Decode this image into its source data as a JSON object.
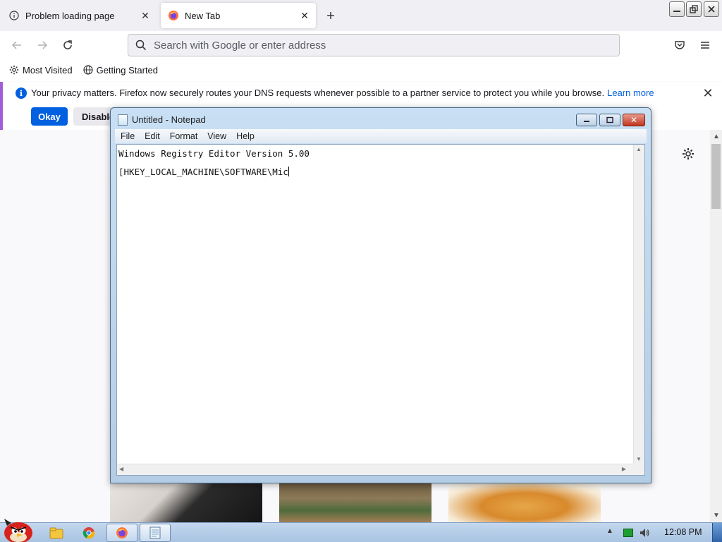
{
  "browser": {
    "tabs": [
      {
        "label": "Problem loading page",
        "icon": "info-icon",
        "active": false
      },
      {
        "label": "New Tab",
        "icon": "firefox-icon",
        "active": true
      }
    ],
    "new_tab_symbol": "+",
    "close_symbol": "✕",
    "address_placeholder": "Search with Google or enter address",
    "bookmarks": [
      {
        "label": "Most Visited",
        "icon": "gear-icon"
      },
      {
        "label": "Getting Started",
        "icon": "globe-icon"
      }
    ],
    "notification": {
      "text": "Your privacy matters. Firefox now securely routes your DNS requests whenever possible to a partner service to protect you while you browse.",
      "link": "Learn more",
      "okay_label": "Okay",
      "disable_label": "Disable"
    },
    "accent_color": "#0060df",
    "notification_border_color": "#a35dd8"
  },
  "notepad": {
    "title": "Untitled - Notepad",
    "menu": [
      "File",
      "Edit",
      "Format",
      "View",
      "Help"
    ],
    "lines": [
      "Windows Registry Editor Version 5.00",
      "[HKEY_LOCAL_MACHINE\\SOFTWARE\\Mic"
    ],
    "close_symbol": "✕"
  },
  "taskbar": {
    "items": [
      "start-angry-bird",
      "windows-explorer",
      "chrome",
      "firefox",
      "notepad"
    ],
    "clock": "12:08 PM"
  }
}
